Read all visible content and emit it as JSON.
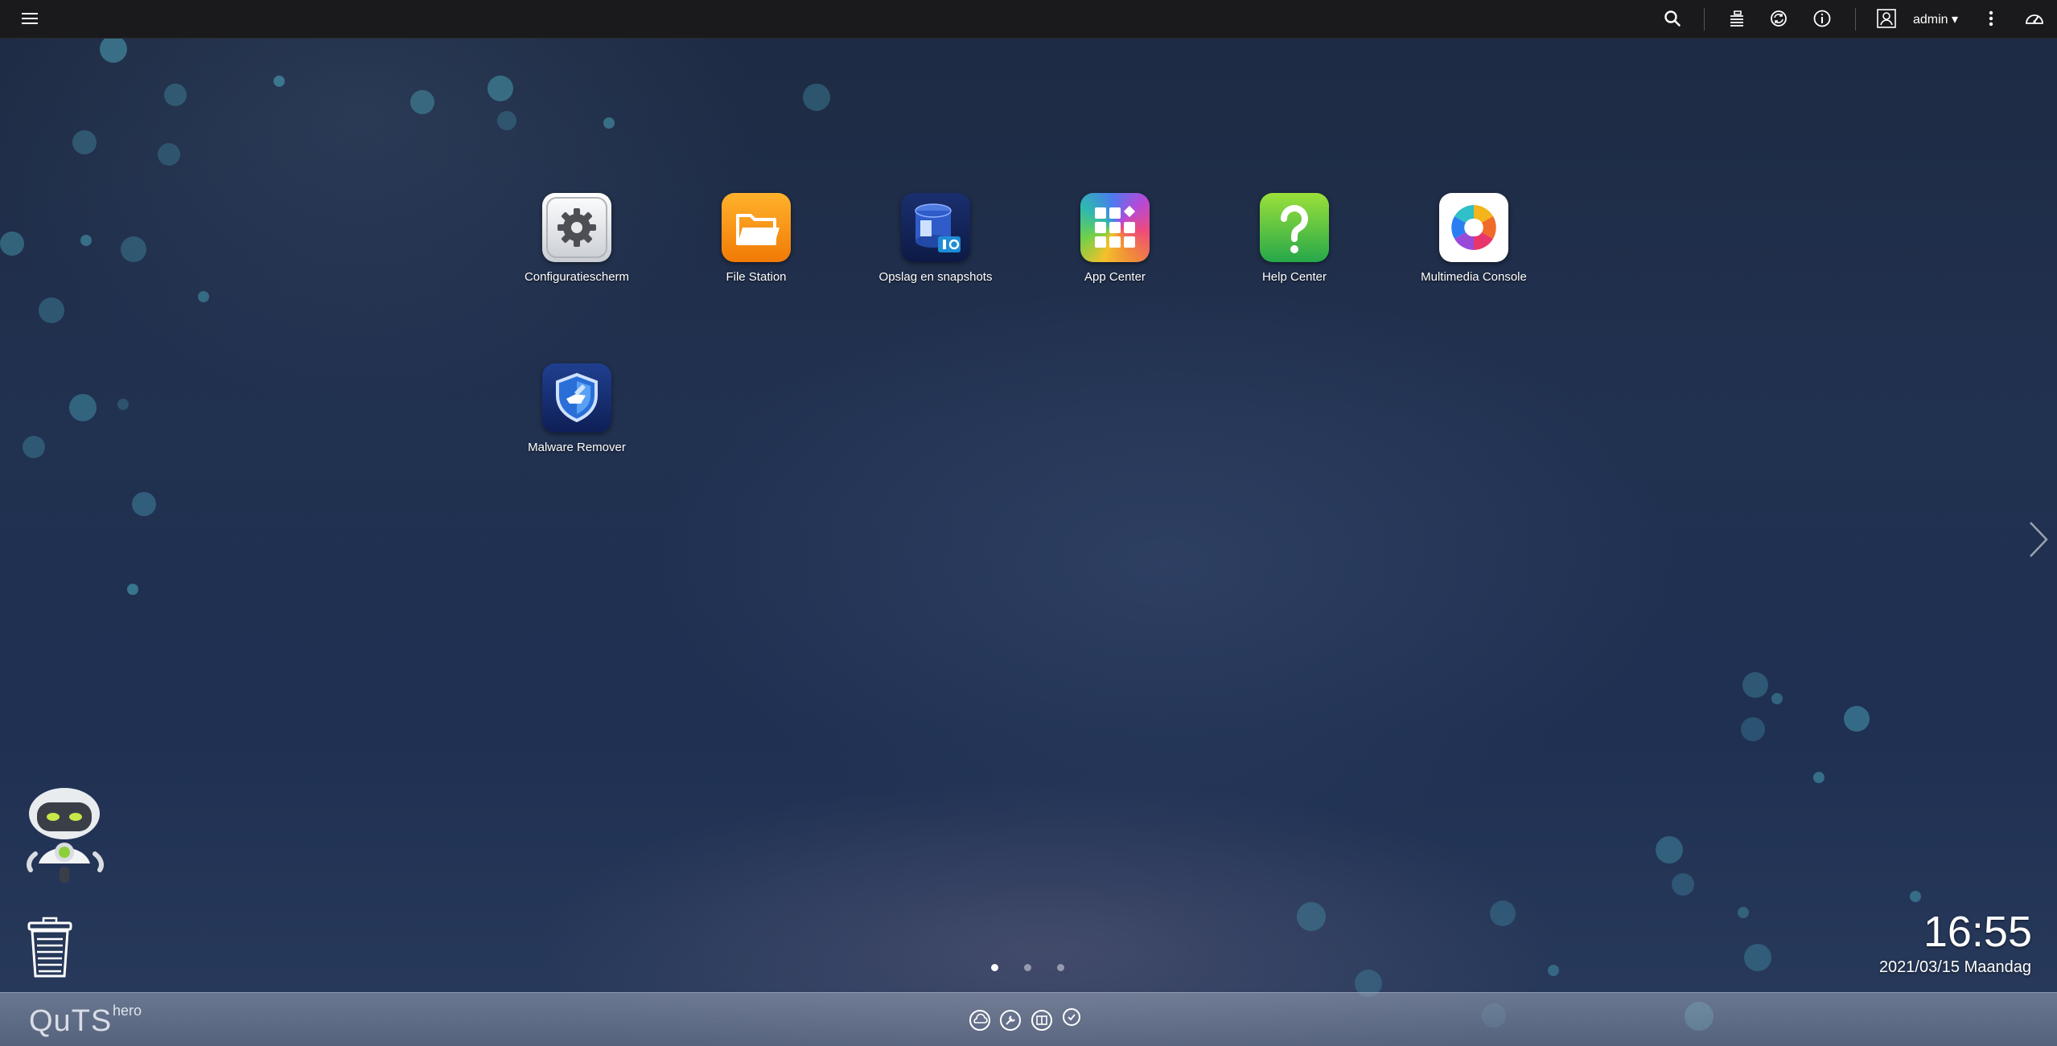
{
  "topbar": {
    "menu_icon": "hamburger-menu-icon",
    "user_label": "admin ▾",
    "icons": [
      "search-icon",
      "task-stack-icon",
      "sync-icon",
      "info-icon",
      "user-avatar-icon",
      "more-vert-icon",
      "dashboard-gauge-icon"
    ]
  },
  "apps": [
    {
      "label": "Configuratiescherm",
      "icon": "settings-gear-icon"
    },
    {
      "label": "File Station",
      "icon": "folder-icon"
    },
    {
      "label": "Opslag en snapshots",
      "icon": "storage-snapshot-icon"
    },
    {
      "label": "App Center",
      "icon": "app-grid-icon"
    },
    {
      "label": "Help Center",
      "icon": "help-question-icon"
    },
    {
      "label": "Multimedia Console",
      "icon": "multimedia-petal-icon"
    },
    {
      "label": "Malware Remover",
      "icon": "shield-icon"
    }
  ],
  "clock": {
    "time": "16:55",
    "date": "2021/03/15 Maandag"
  },
  "pagination": {
    "pages": 3,
    "current": 1
  },
  "brand": {
    "name": "QuTS",
    "sup": "hero"
  },
  "colors": {
    "topbar": "#1a1a1c",
    "desktop": "#1f2f4f",
    "accent": "#4aa3b8"
  }
}
